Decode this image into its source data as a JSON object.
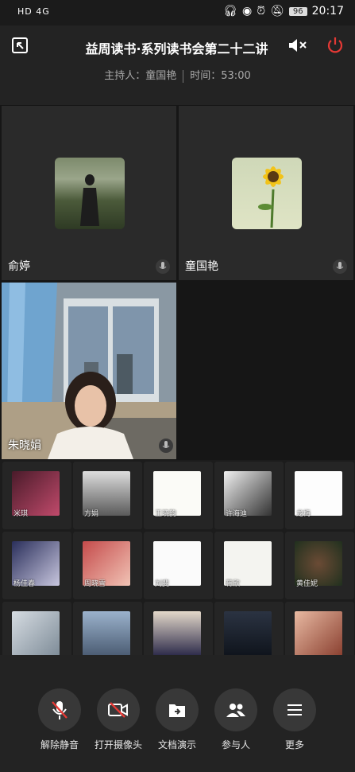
{
  "status": {
    "network": "HD 4G",
    "battery": "96",
    "time": "20:17"
  },
  "header": {
    "title": "益周读书·系列读书会第二十二讲",
    "host_label": "主持人：童国艳",
    "time_label": "时间：53:00"
  },
  "video_tiles": [
    {
      "name": "俞婷",
      "icon": "mic-icon"
    },
    {
      "name": "童国艳",
      "icon": "mic-icon"
    },
    {
      "name": "朱晓娟",
      "icon": "mic-icon"
    }
  ],
  "participants": [
    [
      "米琪",
      "方娟",
      "王晓韵",
      "许海迪",
      "龙梅"
    ],
    [
      "杨佳春",
      "周晓雪",
      "刘斐",
      "蒋欣",
      "黄佳妮"
    ],
    [
      "",
      "",
      "",
      "",
      ""
    ]
  ],
  "toolbar": {
    "unmute": "解除静音",
    "camera": "打开摄像头",
    "docs": "文档演示",
    "participants": "参与人",
    "more": "更多"
  },
  "colors": {
    "background": "#232323",
    "end_call": "#e53935"
  }
}
